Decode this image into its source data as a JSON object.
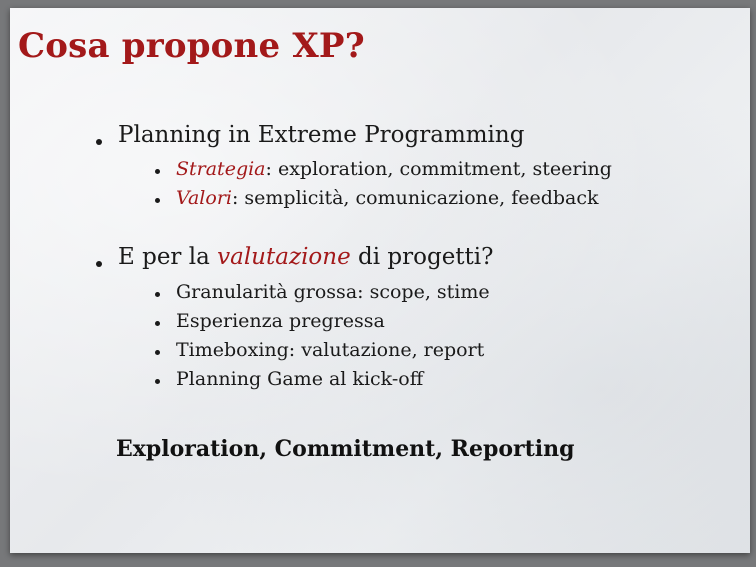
{
  "slide": {
    "title": "Cosa propone XP?",
    "section1": {
      "heading": "Planning in Extreme Programming",
      "items": [
        {
          "term": "Strategia",
          "text": ": exploration, commitment, steering"
        },
        {
          "term": "Valori",
          "text": ": semplicità, comunicazione, feedback"
        }
      ]
    },
    "section2": {
      "heading_pre": "E per la ",
      "heading_em": "valutazione",
      "heading_post": " di progetti?",
      "items": [
        "Granularità grossa: scope, stime",
        "Esperienza pregressa",
        "Timeboxing: valutazione, report",
        "Planning Game al kick-off"
      ]
    },
    "closing": "Exploration, Commitment, Reporting"
  },
  "colors": {
    "accent": "#a3191a",
    "text": "#1a1a1a",
    "frame": "#77787a"
  }
}
